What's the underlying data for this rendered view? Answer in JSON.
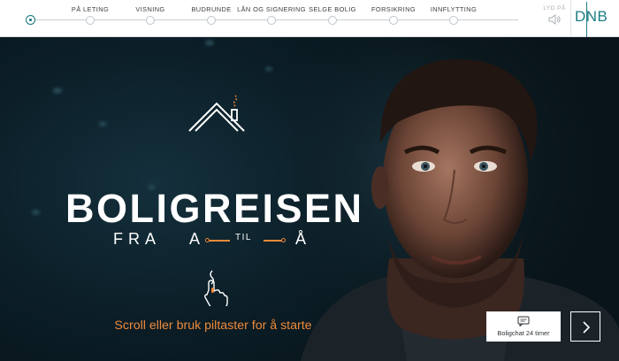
{
  "nav": {
    "steps": [
      {
        "label": "PÅ LETING"
      },
      {
        "label": "VISNING"
      },
      {
        "label": "BUDRUNDE"
      },
      {
        "label": "LÅN OG SIGNERING"
      },
      {
        "label": "SELGE BOLIG"
      },
      {
        "label": "FORSIKRING"
      },
      {
        "label": "INNFLYTTING"
      }
    ],
    "sound_label": "LYD PÅ",
    "sound_icon": "speaker-icon",
    "logo": "DNB"
  },
  "hero": {
    "headline": "BOLIGREISEN",
    "tagline": {
      "from": "FRA",
      "a": "A",
      "til": "TIL",
      "aa": "Å"
    },
    "instruction": "Scroll eller bruk piltaster for å starte",
    "icons": [
      "roof-chimney-icon",
      "scroll-hand-icon"
    ]
  },
  "chat": {
    "label": "Boligchat 24 timer",
    "icon": "chat-bubble-icon"
  },
  "next": {
    "icon": "chevron-right-icon"
  },
  "colors": {
    "accent": "#ef8a3a",
    "brand": "#1d7d84",
    "background": "#0b1a22"
  }
}
